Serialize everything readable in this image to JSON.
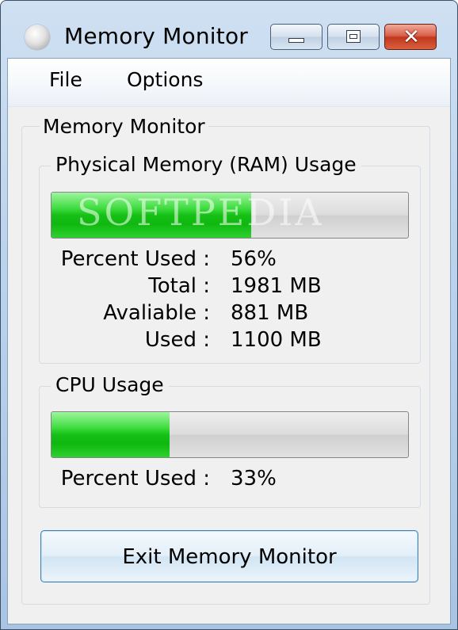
{
  "window": {
    "title": "Memory Monitor"
  },
  "menu": {
    "file": "File",
    "options": "Options"
  },
  "outer_group": {
    "label": "Memory Monitor"
  },
  "ram": {
    "group_label": "Physical Memory (RAM) Usage",
    "percent_used_fraction": 0.56,
    "percent_label": "Percent Used :",
    "percent_value": "56%",
    "total_label": "Total :",
    "total_value": "1981 MB",
    "available_label": "Avaliable :",
    "available_value": "881 MB",
    "used_label": "Used :",
    "used_value": "1100 MB"
  },
  "cpu": {
    "group_label": "CPU Usage",
    "percent_used_fraction": 0.33,
    "percent_label": "Percent Used :",
    "percent_value": "33%"
  },
  "exit_button": {
    "label": "Exit Memory Monitor"
  },
  "watermark": "SOFTPEDIA",
  "colors": {
    "progress_fill": "#16c016",
    "window_chrome": "#bcd3ec",
    "close_button": "#c2381d"
  },
  "icons": {
    "app": "memory-app-icon",
    "minimize": "minimize-icon",
    "maximize": "maximize-icon",
    "close": "close-icon"
  }
}
